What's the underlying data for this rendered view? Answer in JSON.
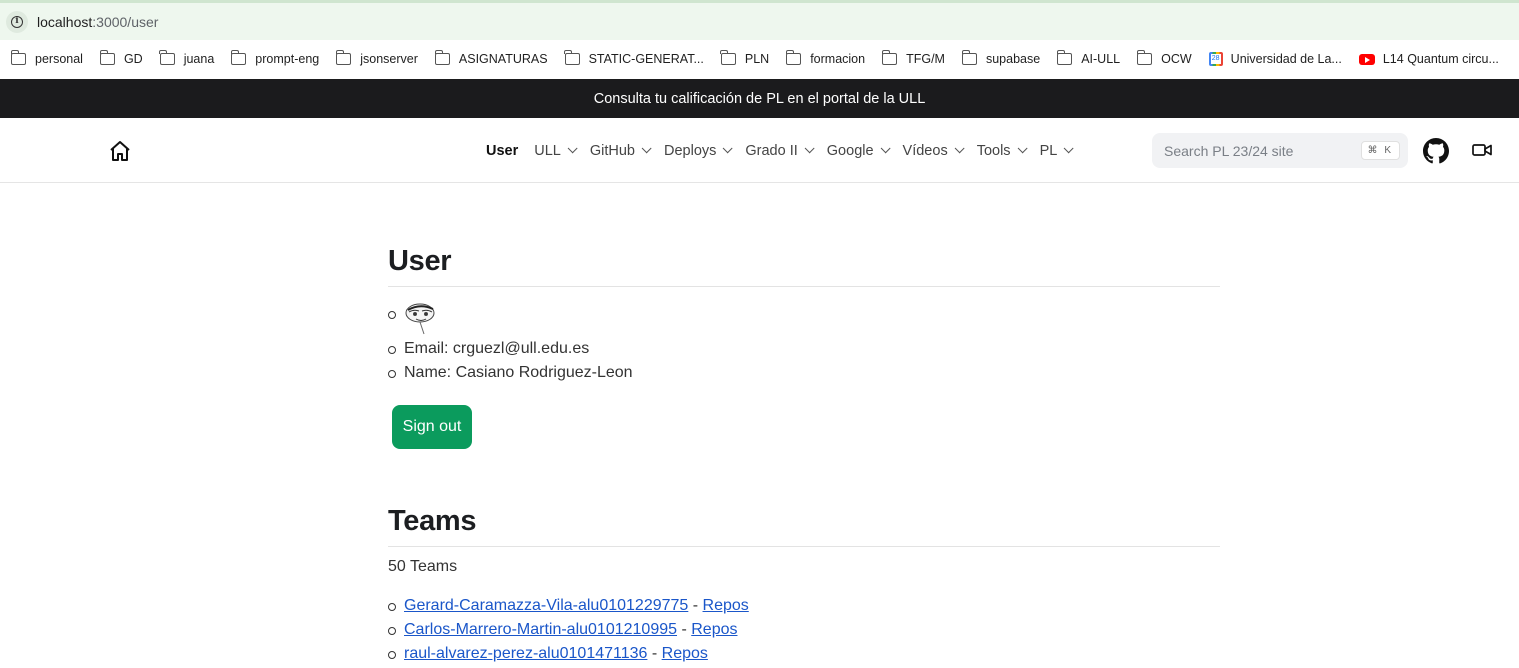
{
  "browser": {
    "url_host": "localhost",
    "url_path": ":3000/user"
  },
  "bookmarks": [
    {
      "label": "personal",
      "icon": "folder-icon"
    },
    {
      "label": "GD",
      "icon": "folder-icon"
    },
    {
      "label": "juana",
      "icon": "folder-icon"
    },
    {
      "label": "prompt-eng",
      "icon": "folder-icon"
    },
    {
      "label": "jsonserver",
      "icon": "folder-icon"
    },
    {
      "label": "ASIGNATURAS",
      "icon": "folder-icon"
    },
    {
      "label": "STATIC-GENERAT...",
      "icon": "folder-icon"
    },
    {
      "label": "PLN",
      "icon": "folder-icon"
    },
    {
      "label": "formacion",
      "icon": "folder-icon"
    },
    {
      "label": "TFG/M",
      "icon": "folder-icon"
    },
    {
      "label": "supabase",
      "icon": "folder-icon"
    },
    {
      "label": "AI-ULL",
      "icon": "folder-icon"
    },
    {
      "label": "OCW",
      "icon": "folder-icon"
    },
    {
      "label": "Universidad de La...",
      "icon": "calendar-icon"
    },
    {
      "label": "L14 Quantum circu...",
      "icon": "youtube-icon"
    }
  ],
  "banner": {
    "text": "Consulta tu calificación de PL en el portal de la ULL"
  },
  "nav": {
    "items": [
      {
        "label": "User",
        "active": true,
        "dropdown": false
      },
      {
        "label": "ULL",
        "dropdown": true
      },
      {
        "label": "GitHub",
        "dropdown": true
      },
      {
        "label": "Deploys",
        "dropdown": true
      },
      {
        "label": "Grado II",
        "dropdown": true
      },
      {
        "label": "Google",
        "dropdown": true
      },
      {
        "label": "Vídeos",
        "dropdown": true
      },
      {
        "label": "Tools",
        "dropdown": true
      },
      {
        "label": "PL",
        "dropdown": true
      }
    ],
    "search_placeholder": "Search PL 23/24 site",
    "search_shortcut": "⌘ K"
  },
  "user": {
    "heading": "User",
    "email_line": "Email: crguezl@ull.edu.es",
    "name_line": "Name: Casiano Rodriguez-Leon",
    "signout_label": "Sign out"
  },
  "teams": {
    "heading": "Teams",
    "count_text": "50 Teams",
    "items": [
      {
        "name": "Gerard-Caramazza-Vila-alu0101229775",
        "sep": " - ",
        "repos": "Repos"
      },
      {
        "name": "Carlos-Marrero-Martin-alu0101210995",
        "sep": " - ",
        "repos": "Repos"
      },
      {
        "name": "raul-alvarez-perez-alu0101471136",
        "sep": " - ",
        "repos": "Repos"
      }
    ]
  },
  "colors": {
    "banner_bg": "#1b1b1d",
    "signout_bg": "#0b9b5d",
    "link": "#1a56c9"
  }
}
